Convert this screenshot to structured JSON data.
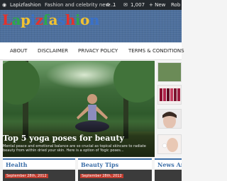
{
  "adminbar": {
    "wp_logo": "wordpress-icon",
    "site_name": "Lapizfashion",
    "tagline": "Fashion and celebrity new...",
    "updates_count": "1",
    "comments_count": "1,007",
    "new_label": "+ New",
    "user_label": "Rob"
  },
  "header": {
    "logo_text": "Lapizfashion",
    "logo_colors": [
      "#e6312b",
      "#2da84a",
      "#f2c230",
      "#3a71c9"
    ]
  },
  "nav": {
    "items": [
      "About",
      "Disclaimer",
      "Privacy Policy",
      "Terms & Conditions"
    ]
  },
  "hero": {
    "title": "Top 5 yoga poses for beauty",
    "excerpt": "Mental peace and emotional balance are so crucial as topical skincare to radiate beauty from within dried your skin. Here is a option of Yogic poses..."
  },
  "sections": [
    {
      "title": "Health",
      "date": "September 28th, 2012"
    },
    {
      "title": "Beauty Tips",
      "date": "September 28th, 2012"
    },
    {
      "title": "News And",
      "date": ""
    }
  ],
  "colors": {
    "adminbar": "#23282d",
    "header": "#4d6f9c",
    "section_accent": "#3d6fa8",
    "date_badge": "#c03c2f"
  }
}
